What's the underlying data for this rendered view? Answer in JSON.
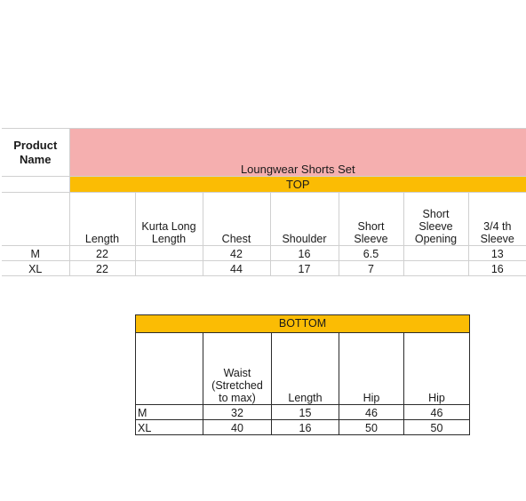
{
  "top_table": {
    "product_name_label": "Product Name",
    "product_title": "Loungwear Shorts Set",
    "section_label": "TOP",
    "colors": {
      "title_band": "#f5afaf",
      "section_band": "#fbbc04",
      "grid": "#d0d0d0"
    },
    "columns": [
      "",
      "Length",
      "Kurta Long Length",
      "Chest",
      "Shoulder",
      "Short Sleeve",
      "Short Sleeve Opening",
      "3/4 th Sleeve"
    ],
    "rows": [
      {
        "size": "M",
        "length": "22",
        "kurta_long_length": "",
        "chest": "42",
        "shoulder": "16",
        "short_sleeve": "6.5",
        "short_sleeve_opening": "",
        "three_quarter_sleeve": "13"
      },
      {
        "size": "XL",
        "length": "22",
        "kurta_long_length": "",
        "chest": "44",
        "shoulder": "17",
        "short_sleeve": "7",
        "short_sleeve_opening": "",
        "three_quarter_sleeve": "16"
      }
    ]
  },
  "bottom_table": {
    "section_label": "BOTTOM",
    "colors": {
      "section_band": "#fbbc04",
      "grid": "#2b2b2b"
    },
    "columns": [
      "",
      "Waist (Stretched to max)",
      "Length",
      "Hip",
      "Hip"
    ],
    "rows": [
      {
        "size": "M",
        "waist": "32",
        "length": "15",
        "hip_1": "46",
        "hip_2": "46"
      },
      {
        "size": "XL",
        "waist": "40",
        "length": "16",
        "hip_1": "50",
        "hip_2": "50"
      }
    ]
  }
}
